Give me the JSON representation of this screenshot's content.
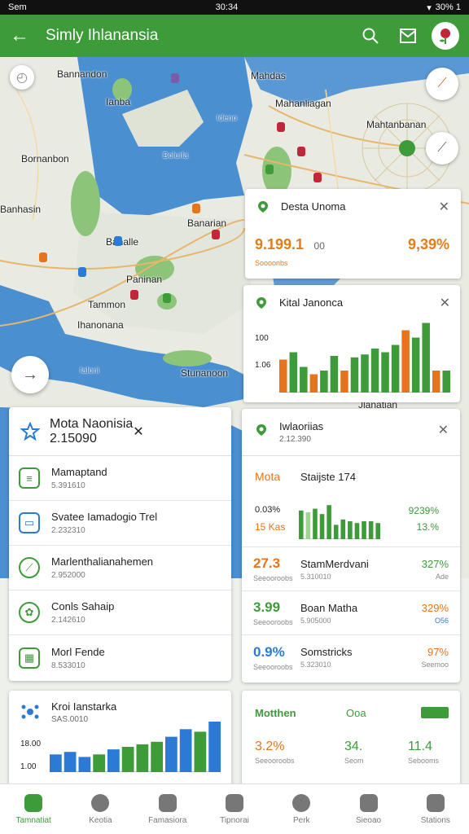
{
  "status": {
    "left": "Sem",
    "time": "30:34",
    "right": "30% 1"
  },
  "appbar": {
    "title": "Simly Ihlanansia"
  },
  "map": {
    "labels": [
      "Bannandon",
      "Mahanliagan",
      "Mahtanbanan",
      "Bornanbon",
      "Ianba",
      "Banarian",
      "Mahdas",
      "Ihanonana",
      "Paninan",
      "Stunanoon",
      "Tammon",
      "Banhasin",
      "Banalle",
      "Jlanatian"
    ],
    "water_labels": [
      "Ideno",
      "Bolurla",
      "Ialoni"
    ]
  },
  "card_top": {
    "title": "Desta Unoma",
    "value": "9.199.1",
    "value_unit": "00",
    "pct": "9,39%",
    "sub": "Soooonbs"
  },
  "card_chart": {
    "title": "Kital Janonca",
    "yticks": [
      "100",
      "1.06"
    ],
    "bars": [
      {
        "v": 0.45,
        "c": "#e6741c"
      },
      {
        "v": 0.55,
        "c": "#3d9b3a"
      },
      {
        "v": 0.35,
        "c": "#3d9b3a"
      },
      {
        "v": 0.25,
        "c": "#e6741c"
      },
      {
        "v": 0.3,
        "c": "#3d9b3a"
      },
      {
        "v": 0.5,
        "c": "#3d9b3a"
      },
      {
        "v": 0.3,
        "c": "#e6741c"
      },
      {
        "v": 0.48,
        "c": "#3d9b3a"
      },
      {
        "v": 0.52,
        "c": "#3d9b3a"
      },
      {
        "v": 0.6,
        "c": "#3d9b3a"
      },
      {
        "v": 0.55,
        "c": "#3d9b3a"
      },
      {
        "v": 0.65,
        "c": "#3d9b3a"
      },
      {
        "v": 0.85,
        "c": "#e6741c"
      },
      {
        "v": 0.75,
        "c": "#3d9b3a"
      },
      {
        "v": 0.95,
        "c": "#3d9b3a"
      },
      {
        "v": 0.3,
        "c": "#e6741c"
      },
      {
        "v": 0.3,
        "c": "#3d9b3a"
      }
    ]
  },
  "list_card": {
    "title": "Mota Naonisia",
    "sub": "2.15090",
    "items": [
      {
        "title": "Mamaptand",
        "sub": "5.391610",
        "icon": "list-icon"
      },
      {
        "title": "Svatee Iamadogio Trel",
        "sub": "2.232310",
        "icon": "card-icon"
      },
      {
        "title": "Marlenthalianahemen",
        "sub": "2.952000",
        "icon": "leaf-icon"
      },
      {
        "title": "Conls Sahaip",
        "sub": "2.142610",
        "icon": "flower-icon"
      },
      {
        "title": "Morl Fende",
        "sub": "8.533010",
        "icon": "grid-icon"
      }
    ]
  },
  "stats_card": {
    "title": "Iwlaoriias",
    "sub": "2.12.390",
    "head_left": "Mota",
    "head_mid": "Staijste 174",
    "chart_left_top": "0.03%",
    "chart_left_bot": "15 Kas",
    "chart_right_top": "9239%",
    "chart_right_bot": "13.%",
    "rows": [
      {
        "val": "27.3",
        "valsub": "Seeooroobs",
        "name": "StamMerdvani",
        "namesub": "5.310010",
        "pct": "327%",
        "pctsub": "Ade",
        "color": "#e6741c"
      },
      {
        "val": "3.99",
        "valsub": "Seeooroobs",
        "name": "Boan Matha",
        "namesub": "5.905000",
        "pct": "329%",
        "pctsub": "O56",
        "color": "#3d9b3a"
      },
      {
        "val": "0.9%",
        "valsub": "Seeooroobs",
        "name": "Somstricks",
        "namesub": "5.323010",
        "pct": "97%",
        "pctsub": "Seemoo",
        "color": "#2b7ad6"
      }
    ],
    "chart_bars": [
      0.8,
      0.75,
      0.85,
      0.7,
      0.95,
      0.4,
      0.55,
      0.5,
      0.45,
      0.5,
      0.5,
      0.45
    ]
  },
  "bottom_left_card": {
    "title": "Kroi Ianstarka",
    "sub": "SAS.0010",
    "yticks": [
      "18.00",
      "1.00"
    ],
    "bars": [
      {
        "v": 0.35,
        "c": "#2b7ad6"
      },
      {
        "v": 0.4,
        "c": "#2b7ad6"
      },
      {
        "v": 0.3,
        "c": "#2b7ad6"
      },
      {
        "v": 0.35,
        "c": "#3d9b3a"
      },
      {
        "v": 0.45,
        "c": "#2b7ad6"
      },
      {
        "v": 0.5,
        "c": "#3d9b3a"
      },
      {
        "v": 0.55,
        "c": "#3d9b3a"
      },
      {
        "v": 0.6,
        "c": "#3d9b3a"
      },
      {
        "v": 0.7,
        "c": "#2b7ad6"
      },
      {
        "v": 0.85,
        "c": "#2b7ad6"
      },
      {
        "v": 0.8,
        "c": "#3d9b3a"
      },
      {
        "v": 1.0,
        "c": "#2b7ad6"
      }
    ]
  },
  "bottom_right_card": {
    "title": "Motthen",
    "mid": "Ooa",
    "badge": "",
    "cols": [
      {
        "v": "3.2%",
        "s": "Seeooroobs",
        "c": "#e6741c"
      },
      {
        "v": "34.",
        "s": "Seom",
        "c": "#3d9b3a"
      },
      {
        "v": "11.4",
        "s": "Sebooms",
        "c": "#3d9b3a"
      }
    ]
  },
  "bottom_nav": [
    {
      "label": "Tamnatiat",
      "active": true
    },
    {
      "label": "Keotia",
      "active": false
    },
    {
      "label": "Famasiora",
      "active": false
    },
    {
      "label": "Tipnorai",
      "active": false
    },
    {
      "label": "Perk",
      "active": false
    },
    {
      "label": "Sieoao",
      "active": false
    },
    {
      "label": "Stations",
      "active": false
    }
  ],
  "colors": {
    "primary": "#3d9b3a",
    "orange": "#e6741c",
    "blue": "#2b7ad6",
    "water": "#4a8fd0"
  }
}
